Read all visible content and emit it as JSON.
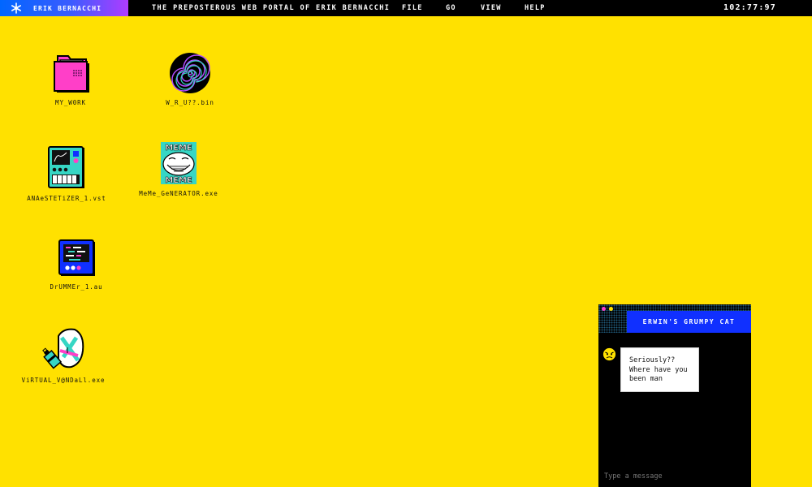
{
  "topbar": {
    "brand": "ERIK BERNACCHI",
    "title": "THE PREPOSTEROUS WEB PORTAL OF ERIK BERNACCHI",
    "menu": [
      "FILE",
      "GO",
      "VIEW",
      "HELP"
    ],
    "clock": "102:77:97"
  },
  "desktop": {
    "icons": [
      {
        "name": "MY_W0RK",
        "icon": "folder-icon"
      },
      {
        "name": "W_R_U??.bin",
        "icon": "spiral-icon"
      },
      {
        "name": "ANAeSTETiZER_1.vst",
        "icon": "synth-icon"
      },
      {
        "name": "MeMe_GeNERATOR.exe",
        "icon": "troll-meme-icon"
      },
      {
        "name": "DrUMMEr_1.au",
        "icon": "drum-machine-icon"
      },
      {
        "name": "ViRTUAL_V@NDaLl.exe",
        "icon": "spray-can-icon"
      }
    ]
  },
  "chat": {
    "title": "ERWIN'S GRUMPY CAT",
    "messages": [
      {
        "text": "Seriously?? Where have you been man"
      }
    ],
    "input_placeholder": "Type a message"
  },
  "colors": {
    "desktop_bg": "#ffe100",
    "topbar_bg": "#000000",
    "brand_gradient": [
      "#0066ff",
      "#b03cff"
    ],
    "chat_title_bg": "#1030ff",
    "accent_pink": "#ff3fc8",
    "accent_cyan": "#36d6c4"
  }
}
